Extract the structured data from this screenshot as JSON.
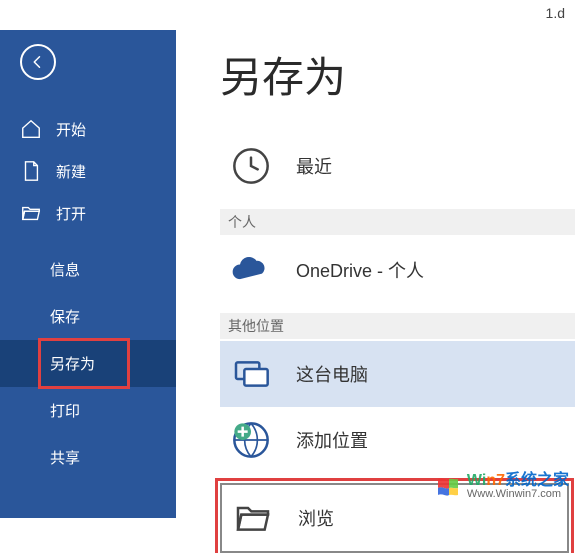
{
  "titlebar": {
    "filename": "1.d"
  },
  "page": {
    "title": "另存为"
  },
  "sidebar": {
    "home": "开始",
    "new": "新建",
    "open": "打开",
    "info": "信息",
    "save": "保存",
    "save_as": "另存为",
    "print": "打印",
    "share": "共享"
  },
  "locations": {
    "recent": "最近",
    "section_personal": "个人",
    "onedrive": {
      "label": "OneDrive - 个人",
      "sub": ""
    },
    "section_other": "其他位置",
    "this_pc": "这台电脑",
    "add_place": "添加位置",
    "browse": "浏览"
  },
  "watermark": {
    "brand1": "Wi",
    "brand2": "n7",
    "brand3": "系统之家",
    "url": "Www.Winwin7.com"
  },
  "colors": {
    "sidebar": "#2a569a",
    "selected_nav": "#194178",
    "selected_loc": "#d7e2f2",
    "highlight": "#e04040"
  }
}
